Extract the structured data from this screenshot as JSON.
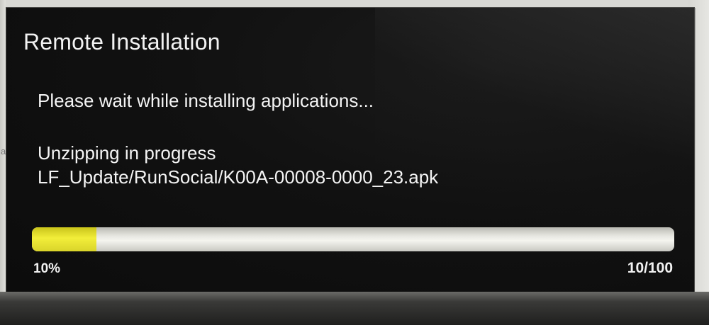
{
  "dialog": {
    "title": "Remote Installation",
    "message": "Please wait while installing applications...",
    "status_line": "Unzipping in progress",
    "file_path": "LF_Update/RunSocial/K00A-00008-0000_23.apk"
  },
  "progress": {
    "fraction": 0.1,
    "percent_label": "10%",
    "count_label": "10/100"
  },
  "colors": {
    "screen_bg": "#111111",
    "text": "#f2f2f2",
    "progress_fill": "#f2ee3a",
    "progress_track": "#e6e6e0"
  }
}
